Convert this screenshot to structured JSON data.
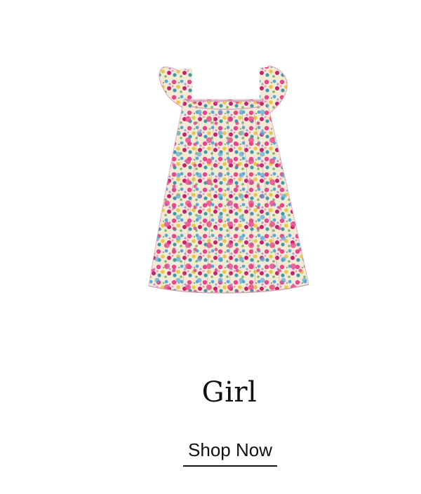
{
  "card": {
    "image": {
      "icon": "floral-dress-icon",
      "colors": {
        "base": "#f4ecd8",
        "pink": "#e8468c",
        "magenta": "#c8206a",
        "blue": "#5aa8d8",
        "teal": "#3e9aa8",
        "yellow": "#e8c84a",
        "green": "#7cb86a",
        "lavender": "#b89ad8"
      }
    },
    "title": "Girl",
    "cta_label": "Shop Now"
  }
}
